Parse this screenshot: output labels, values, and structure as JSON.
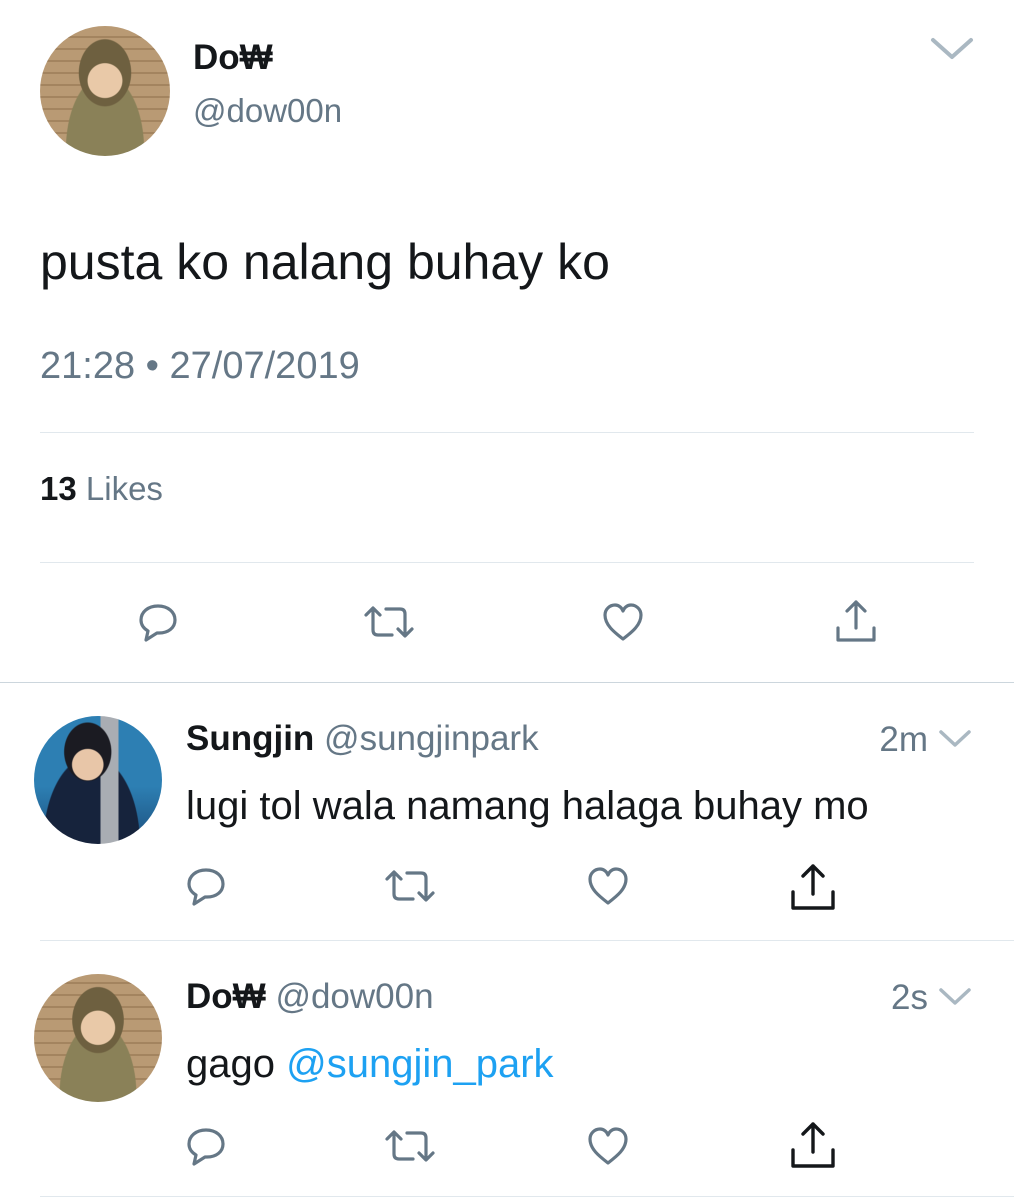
{
  "main_tweet": {
    "name": "Do₩",
    "handle": "@dow00n",
    "text": "pusta ko nalang buhay ko",
    "time": "21:28",
    "separator": "•",
    "date": "27/07/2019",
    "likes_count": "13",
    "likes_label": "Likes"
  },
  "replies": [
    {
      "name": "Sungjin",
      "handle": "@sungjinpark",
      "age": "2m",
      "text": "lugi tol wala namang halaga buhay mo"
    },
    {
      "name": "Do₩",
      "handle": "@dow00n",
      "age": "2s",
      "text": "gago",
      "mention": "@sungjin_park"
    }
  ],
  "icons": [
    "chevron-down-icon",
    "reply-icon",
    "retweet-icon",
    "like-icon",
    "share-icon"
  ],
  "colors": {
    "text": "#14171a",
    "muted": "#657786",
    "link": "#1da1f2",
    "divider": "#e1e8ed"
  }
}
